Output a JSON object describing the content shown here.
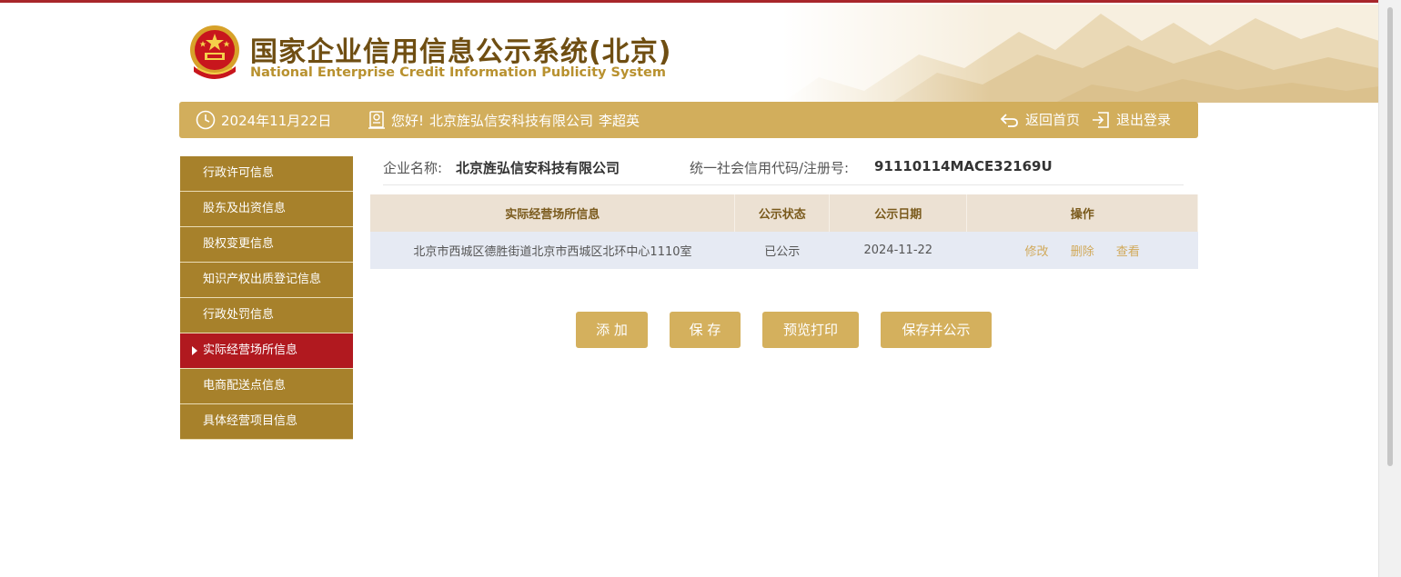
{
  "site": {
    "title": "国家企业信用信息公示系统(北京)",
    "subtitle": "National Enterprise Credit Information Publicity System"
  },
  "header": {
    "date": "2024年11月22日",
    "greeting": "您好!",
    "company": "北京旌弘信安科技有限公司",
    "user": "李超英",
    "home_link": "返回首页",
    "logout_link": "退出登录"
  },
  "sidebar": {
    "items": [
      {
        "label": "行政许可信息",
        "active": false
      },
      {
        "label": "股东及出资信息",
        "active": false
      },
      {
        "label": "股权变更信息",
        "active": false
      },
      {
        "label": "知识产权出质登记信息",
        "active": false
      },
      {
        "label": "行政处罚信息",
        "active": false
      },
      {
        "label": "实际经营场所信息",
        "active": true
      },
      {
        "label": "电商配送点信息",
        "active": false
      },
      {
        "label": "具体经营项目信息",
        "active": false
      }
    ]
  },
  "company_info": {
    "name_label": "企业名称:",
    "name": "北京旌弘信安科技有限公司",
    "code_label": "统一社会信用代码/注册号:",
    "code": "91110114MACE32169U"
  },
  "table": {
    "headers": [
      "实际经营场所信息",
      "公示状态",
      "公示日期",
      "操作"
    ],
    "rows": [
      {
        "address": "北京市西城区德胜街道北京市西城区北环中心1110室",
        "status": "已公示",
        "date": "2024-11-22",
        "actions": [
          "修改",
          "删除",
          "查看"
        ]
      }
    ]
  },
  "buttons": {
    "add": "添 加",
    "save": "保 存",
    "preview": "预览打印",
    "save_publish": "保存并公示"
  },
  "colors": {
    "gold": "#d2ae5c",
    "sidebar": "#a7812b",
    "active": "#b1191f",
    "title": "#6f4e12"
  },
  "icons": [
    "emblem-icon",
    "clock-icon",
    "user-badge-icon",
    "return-icon",
    "logout-icon"
  ]
}
